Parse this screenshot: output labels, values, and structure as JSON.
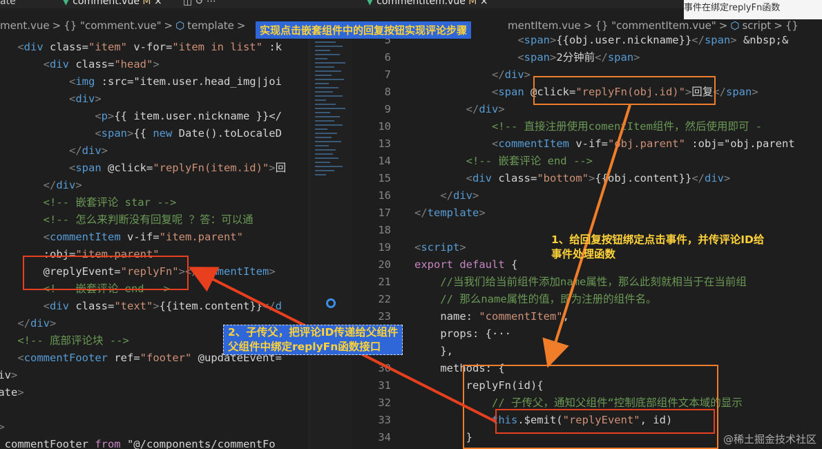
{
  "tabs": {
    "left_partial": "ate",
    "left_file": "comment.vue",
    "left_flag": "M",
    "right_file": "commentItem.vue",
    "right_flag": "M",
    "right_overflow": "事件在绑定replyFn函数"
  },
  "breadcrumbs_left": [
    "ment.vue",
    ">",
    "{} \"comment.vue\"",
    ">",
    "template",
    ">"
  ],
  "breadcrumbs_right": [
    "mentItem.vue",
    ">",
    "{} \"commentItem.vue\"",
    ">",
    "script",
    ">",
    "{}"
  ],
  "title_banner": "实现点击嵌套组件中的回复按钮实现评论步骤",
  "left_code": [
    "    <div class=\"item\" v-for=\"item in list\" :k",
    "        <div class=\"head\">",
    "            <img :src=\"item.user.head_img|joi",
    "            <div>",
    "                <p>{{ item.user.nickname }}</",
    "                <span>{{ new Date().toLocaleD",
    "            </div>",
    "            <span @click=\"replyFn(item.id)\">回",
    "        </div>",
    "        <!-- 嵌套评论 star -->",
    "        <!-- 怎么来判断没有回复呢 ？答：可以通",
    "        <commentItem v-if=\"item.parent\"",
    "        :obj=\"item.parent\"",
    "        @replyEvent=\"replyFn\"></commentItem>",
    "        <!-- 嵌套评论 end -->",
    "        <div class=\"text\">{{item.content}}</d",
    "    </div>",
    "    <!-- 底部评论块 -->",
    "    <commentFooter ref=\"footer\" @updateEvent=",
    "div>",
    "late>",
    "",
    "t>",
    "  commentFooter from \"@/components/commentFo"
  ],
  "right_code": [
    {
      "n": "5",
      "t": "                <span>{{obj.user.nickname}}</span> &nbsp;&"
    },
    {
      "n": "6",
      "t": "                <span>2分钟前</span>"
    },
    {
      "n": "7",
      "t": "            </div>"
    },
    {
      "n": "8",
      "t": "            <span @click=\"replyFn(obj.id)\">回复</span>"
    },
    {
      "n": "9",
      "t": "        </div>"
    },
    {
      "n": "10",
      "t": "            <!-- 直接注册使用comentItem组件，然后使用即可 -"
    },
    {
      "n": "13",
      "t": "            <commentItem v-if=\"obj.parent\" :obj=\"obj.parent"
    },
    {
      "n": "14",
      "t": "        <!-- 嵌套评论 end -->"
    },
    {
      "n": "15",
      "t": "        <div class=\"bottom\">{{obj.content}}</div>"
    },
    {
      "n": "16",
      "t": "    </div>"
    },
    {
      "n": "17",
      "t": "</template>"
    },
    {
      "n": "18",
      "t": ""
    },
    {
      "n": "19",
      "t": "<script>"
    },
    {
      "n": "20",
      "t": "export default {"
    },
    {
      "n": "21",
      "t": "    //当我们给当前组件添加name属性，那么此刻就相当于在当前组"
    },
    {
      "n": "22",
      "t": "    // 那么name属性的值，即为注册的组件名。"
    },
    {
      "n": "23",
      "t": "    name: \"commentItem\","
    },
    {
      "n": "24",
      "t": "    props: {···"
    },
    {
      "n": "29",
      "t": "    },"
    },
    {
      "n": "30",
      "t": "    methods: {"
    },
    {
      "n": "31",
      "t": "        replyFn(id){"
    },
    {
      "n": "32",
      "t": "            // 子传父，通知父组件“控制底部组件文本域的显示"
    },
    {
      "n": "33",
      "t": "            this.$emit(\"replyEvent\", id)"
    },
    {
      "n": "34",
      "t": "        }"
    }
  ],
  "annotations": {
    "step1_line1": "1、给回复按钮绑定点击事件，并传评论ID给",
    "step1_line2": "事件处理函数",
    "step2_line1": "2、子传父，把评论ID传递给父组件",
    "step2_line2": "父组件中绑定replyFn函数接口"
  },
  "watermark": "@稀土掘金技术社区",
  "colors": {
    "red_box": "#e8401e",
    "orange_box": "#f07d2a",
    "banner_bg": "#2f66d8",
    "annotation_text": "#ffd23a"
  }
}
